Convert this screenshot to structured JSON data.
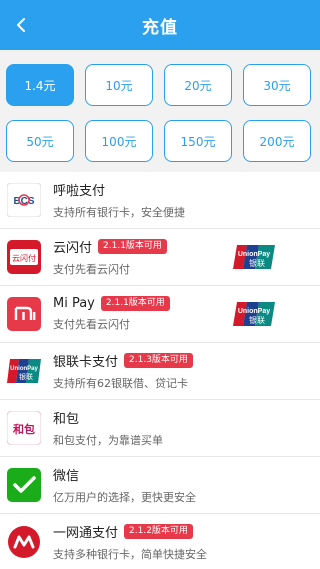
{
  "header": {
    "title": "充值",
    "back_icon": "back-arrow-icon"
  },
  "amounts": [
    {
      "label": "1.4元",
      "selected": true
    },
    {
      "label": "10元",
      "selected": false
    },
    {
      "label": "20元",
      "selected": false
    },
    {
      "label": "30元",
      "selected": false
    },
    {
      "label": "50元",
      "selected": false
    },
    {
      "label": "100元",
      "selected": false
    },
    {
      "label": "150元",
      "selected": false
    },
    {
      "label": "200元",
      "selected": false
    }
  ],
  "payments": [
    {
      "name": "呼啦支付",
      "desc": "支持所有银行卡，安全便捷",
      "badge": "",
      "icon": "bcs-icon",
      "unionpay": false
    },
    {
      "name": "云闪付",
      "desc": "支付先看云闪付",
      "badge": "2.1.1版本可用",
      "icon": "quickpass-icon",
      "unionpay": true
    },
    {
      "name": "Mi Pay",
      "desc": "支付先看云闪付",
      "badge": "2.1.1版本可用",
      "icon": "mi-icon",
      "unionpay": true
    },
    {
      "name": "银联卡支付",
      "desc": "支持所有62银联借、贷记卡",
      "badge": "2.1.3版本可用",
      "icon": "unionpay-card-icon",
      "unionpay": false
    },
    {
      "name": "和包",
      "desc": "和包支付，为靠谱买单",
      "badge": "",
      "icon": "hebao-icon",
      "unionpay": false
    },
    {
      "name": "微信",
      "desc": "亿万用户的选择，更快更安全",
      "badge": "",
      "icon": "wechat-icon",
      "unionpay": false
    },
    {
      "name": "一网通支付",
      "desc": "支持多种银行卡，简单快捷安全",
      "badge": "2.1.2版本可用",
      "icon": "cmb-icon",
      "unionpay": false
    }
  ],
  "logo_text": {
    "bcs": "BCS",
    "quickpass": "云闪付",
    "unionpay_en": "UnionPay",
    "unionpay_cn": "银联",
    "hebao": "和包"
  },
  "colors": {
    "accent": "#2aa0ee",
    "badge": "#e6394a",
    "wechat": "#1aad19",
    "mi": "#e6394a",
    "cmb": "#d3192a"
  }
}
